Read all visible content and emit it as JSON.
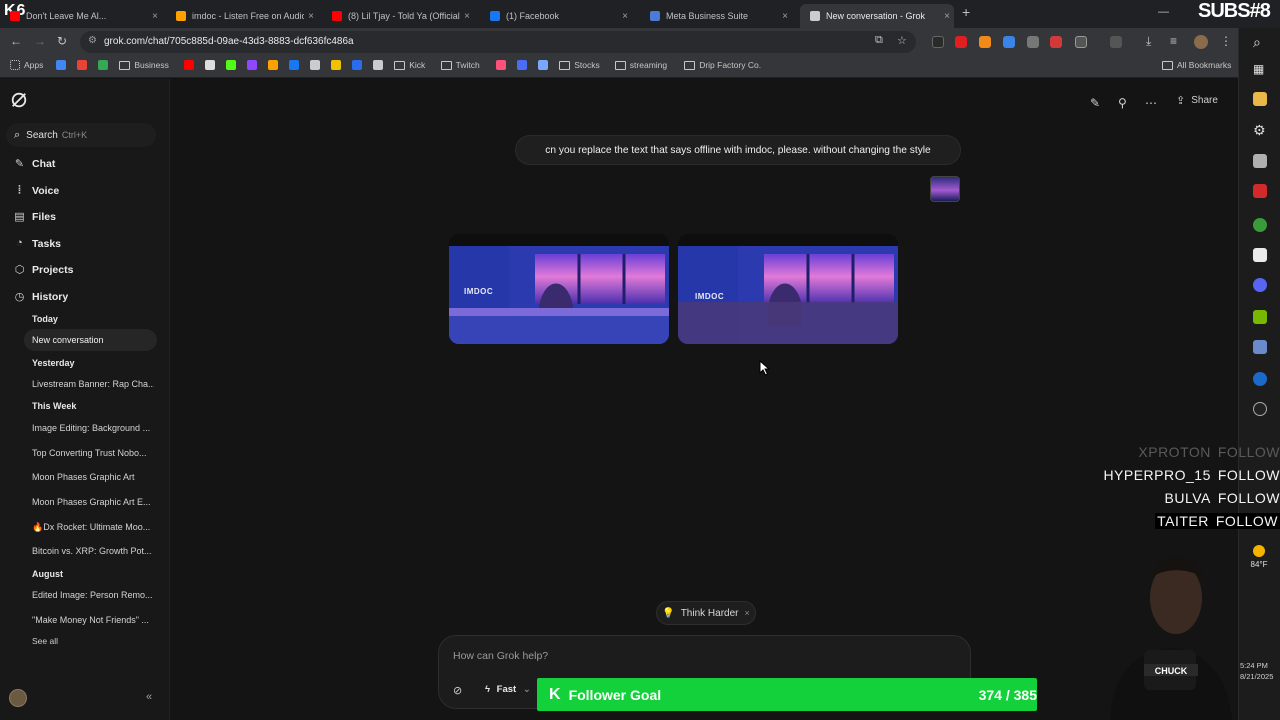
{
  "stream": {
    "brand_left": "K6",
    "brand_right": "SUBS#8",
    "follow_entries": [
      {
        "user": "XPROTON",
        "action": "FOLLOW"
      },
      {
        "user": "HYPERPRO_15",
        "action": "FOLLOW"
      },
      {
        "user": "BULVA",
        "action": "FOLLOW"
      },
      {
        "user": "TAITER",
        "action": "FOLLOW"
      }
    ],
    "goal": {
      "label": "Follower Goal",
      "current": 374,
      "target": 385,
      "count_text": "374 / 385"
    },
    "weather": {
      "temp": "84°F"
    },
    "clock": {
      "time": "5:24 PM",
      "date": "8/21/2025"
    },
    "webcam_shirt_text": "CHUCK"
  },
  "browser": {
    "tabs": [
      {
        "label": "Don't Leave Me Al...",
        "icon_color": "#ff0000"
      },
      {
        "label": "imdoc - Listen Free on Audiomack",
        "icon_color": "#ffa200"
      },
      {
        "label": "(8) Lil Tjay - Told Ya (Official...",
        "icon_color": "#ff0000"
      },
      {
        "label": "(1) Facebook",
        "icon_color": "#1877f2"
      },
      {
        "label": "Meta Business Suite",
        "icon_color": "#4a7bd8"
      },
      {
        "label": "New conversation - Grok",
        "icon_color": "#cccccc"
      }
    ],
    "url": "grok.com/chat/705c885d-09ae-43d3-8883-dcf636fc486a",
    "bookmarks": [
      {
        "label": "Apps",
        "kind": "grid"
      },
      {
        "label": "",
        "kind": "icon",
        "color": "#4285f4"
      },
      {
        "label": "",
        "kind": "icon",
        "color": "#ea4335"
      },
      {
        "label": "",
        "kind": "icon",
        "color": "#34a853"
      },
      {
        "label": "Business",
        "kind": "folder"
      },
      {
        "label": "",
        "kind": "icon",
        "color": "#ff0000"
      },
      {
        "label": "",
        "kind": "icon",
        "color": "#dddddd"
      },
      {
        "label": "",
        "kind": "icon",
        "color": "#53fc18"
      },
      {
        "label": "",
        "kind": "icon",
        "color": "#9146ff"
      },
      {
        "label": "",
        "kind": "icon",
        "color": "#ffa200"
      },
      {
        "label": "",
        "kind": "icon",
        "color": "#1877f2"
      },
      {
        "label": "",
        "kind": "icon",
        "color": "#cccccc"
      },
      {
        "label": "",
        "kind": "icon",
        "color": "#f2c200"
      },
      {
        "label": "",
        "kind": "icon",
        "color": "#2a6cf0"
      },
      {
        "label": "",
        "kind": "icon",
        "color": "#cccccc"
      },
      {
        "label": "Kick",
        "kind": "folder"
      },
      {
        "label": "Twitch",
        "kind": "folder"
      },
      {
        "label": "",
        "kind": "icon",
        "color": "#ff4f7b"
      },
      {
        "label": "",
        "kind": "icon",
        "color": "#4a6cf7"
      },
      {
        "label": "",
        "kind": "icon",
        "color": "#7aa7ff"
      },
      {
        "label": "Stocks",
        "kind": "folder"
      },
      {
        "label": "streaming",
        "kind": "folder"
      },
      {
        "label": "Drip Factory Co.",
        "kind": "folder"
      }
    ],
    "all_bookmarks": "All Bookmarks"
  },
  "sidebar": {
    "search": {
      "label": "Search",
      "shortcut": "Ctrl+K"
    },
    "nav": [
      {
        "label": "Chat",
        "icon": "chat-icon"
      },
      {
        "label": "Voice",
        "icon": "voice-icon"
      },
      {
        "label": "Files",
        "icon": "files-icon"
      },
      {
        "label": "Tasks",
        "icon": "tasks-icon"
      },
      {
        "label": "Projects",
        "icon": "projects-icon"
      },
      {
        "label": "History",
        "icon": "history-icon"
      }
    ],
    "history": {
      "today_label": "Today",
      "today": [
        "New conversation"
      ],
      "yesterday_label": "Yesterday",
      "yesterday": [
        "Livestream Banner: Rap Cha..."
      ],
      "week_label": "This Week",
      "week": [
        "Image Editing: Background ...",
        "Top Converting Trust Nobo...",
        "Moon Phases Graphic Art",
        "Moon Phases Graphic Art E...",
        "🔥Dx Rocket: Ultimate Moo...",
        "Bitcoin vs. XRP: Growth Pot..."
      ],
      "august_label": "August",
      "august": [
        "Edited Image: Person Remo...",
        "\"Make Money Not Friends\" ..."
      ],
      "see_all": "See all"
    }
  },
  "main": {
    "share_label": "Share",
    "user_message": "cn you replace the text that says offline with imdoc, please. without changing the style",
    "generated_images": [
      {
        "brand_text": "IMDOC"
      },
      {
        "brand_text": "IMDOC"
      }
    ],
    "think_harder": "Think Harder",
    "composer": {
      "placeholder": "How can Grok help?",
      "model": "Fast"
    }
  }
}
